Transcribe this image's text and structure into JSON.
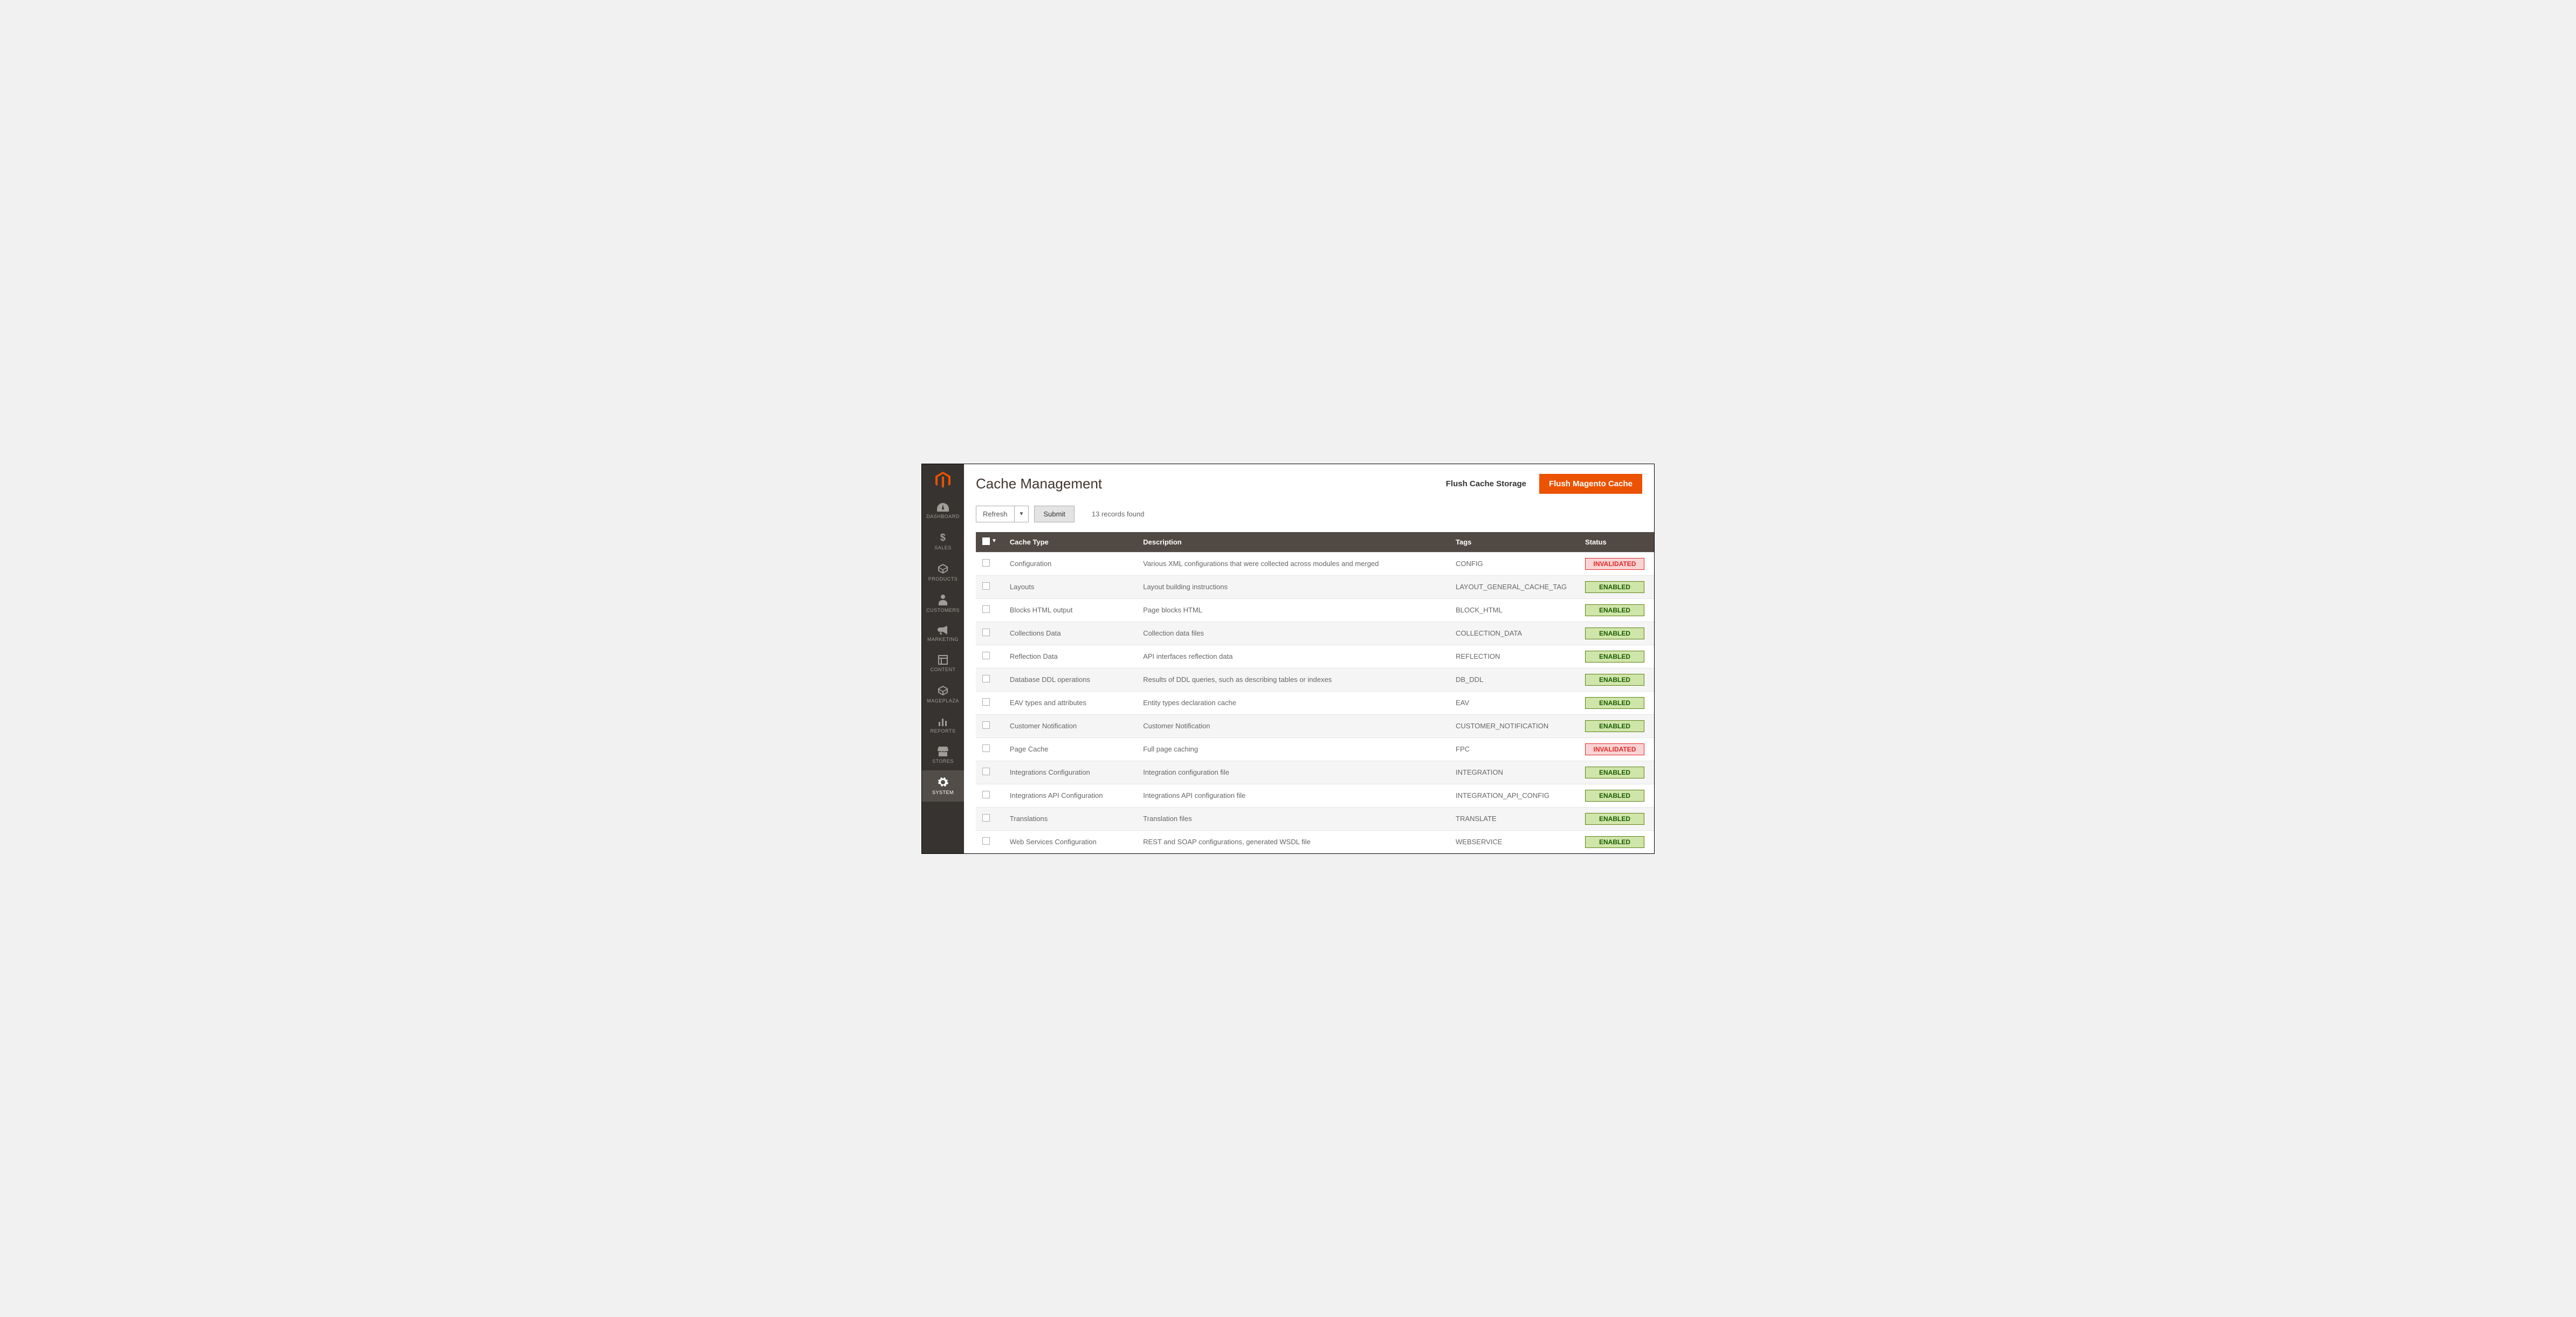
{
  "sidebar": {
    "items": [
      {
        "label": "DASHBOARD",
        "name": "sidebar-item-dashboard",
        "icon": "dashboard-icon"
      },
      {
        "label": "SALES",
        "name": "sidebar-item-sales",
        "icon": "dollar-icon"
      },
      {
        "label": "PRODUCTS",
        "name": "sidebar-item-products",
        "icon": "cube-icon"
      },
      {
        "label": "CUSTOMERS",
        "name": "sidebar-item-customers",
        "icon": "person-icon"
      },
      {
        "label": "MARKETING",
        "name": "sidebar-item-marketing",
        "icon": "megaphone-icon"
      },
      {
        "label": "CONTENT",
        "name": "sidebar-item-content",
        "icon": "layout-icon"
      },
      {
        "label": "MAGEPLAZA",
        "name": "sidebar-item-mageplaza",
        "icon": "package-icon"
      },
      {
        "label": "REPORTS",
        "name": "sidebar-item-reports",
        "icon": "bar-chart-icon"
      },
      {
        "label": "STORES",
        "name": "sidebar-item-stores",
        "icon": "storefront-icon"
      },
      {
        "label": "SYSTEM",
        "name": "sidebar-item-system",
        "icon": "gear-icon",
        "active": true
      }
    ]
  },
  "header": {
    "title": "Cache Management",
    "flush_storage_label": "Flush Cache Storage",
    "flush_magento_label": "Flush Magento Cache"
  },
  "toolbar": {
    "action_label": "Refresh",
    "submit_label": "Submit",
    "records_text": "13 records found"
  },
  "grid": {
    "columns": {
      "type": "Cache Type",
      "description": "Description",
      "tags": "Tags",
      "status": "Status"
    },
    "rows": [
      {
        "type": "Configuration",
        "description": "Various XML configurations that were collected across modules and merged",
        "tags": "CONFIG",
        "status": "INVALIDATED"
      },
      {
        "type": "Layouts",
        "description": "Layout building instructions",
        "tags": "LAYOUT_GENERAL_CACHE_TAG",
        "status": "ENABLED"
      },
      {
        "type": "Blocks HTML output",
        "description": "Page blocks HTML",
        "tags": "BLOCK_HTML",
        "status": "ENABLED"
      },
      {
        "type": "Collections Data",
        "description": "Collection data files",
        "tags": "COLLECTION_DATA",
        "status": "ENABLED"
      },
      {
        "type": "Reflection Data",
        "description": "API interfaces reflection data",
        "tags": "REFLECTION",
        "status": "ENABLED"
      },
      {
        "type": "Database DDL operations",
        "description": "Results of DDL queries, such as describing tables or indexes",
        "tags": "DB_DDL",
        "status": "ENABLED"
      },
      {
        "type": "EAV types and attributes",
        "description": "Entity types declaration cache",
        "tags": "EAV",
        "status": "ENABLED"
      },
      {
        "type": "Customer Notification",
        "description": "Customer Notification",
        "tags": "CUSTOMER_NOTIFICATION",
        "status": "ENABLED"
      },
      {
        "type": "Page Cache",
        "description": "Full page caching",
        "tags": "FPC",
        "status": "INVALIDATED"
      },
      {
        "type": "Integrations Configuration",
        "description": "Integration configuration file",
        "tags": "INTEGRATION",
        "status": "ENABLED"
      },
      {
        "type": "Integrations API Configuration",
        "description": "Integrations API configuration file",
        "tags": "INTEGRATION_API_CONFIG",
        "status": "ENABLED"
      },
      {
        "type": "Translations",
        "description": "Translation files",
        "tags": "TRANSLATE",
        "status": "ENABLED"
      },
      {
        "type": "Web Services Configuration",
        "description": "REST and SOAP configurations, generated WSDL file",
        "tags": "WEBSERVICE",
        "status": "ENABLED"
      }
    ]
  }
}
